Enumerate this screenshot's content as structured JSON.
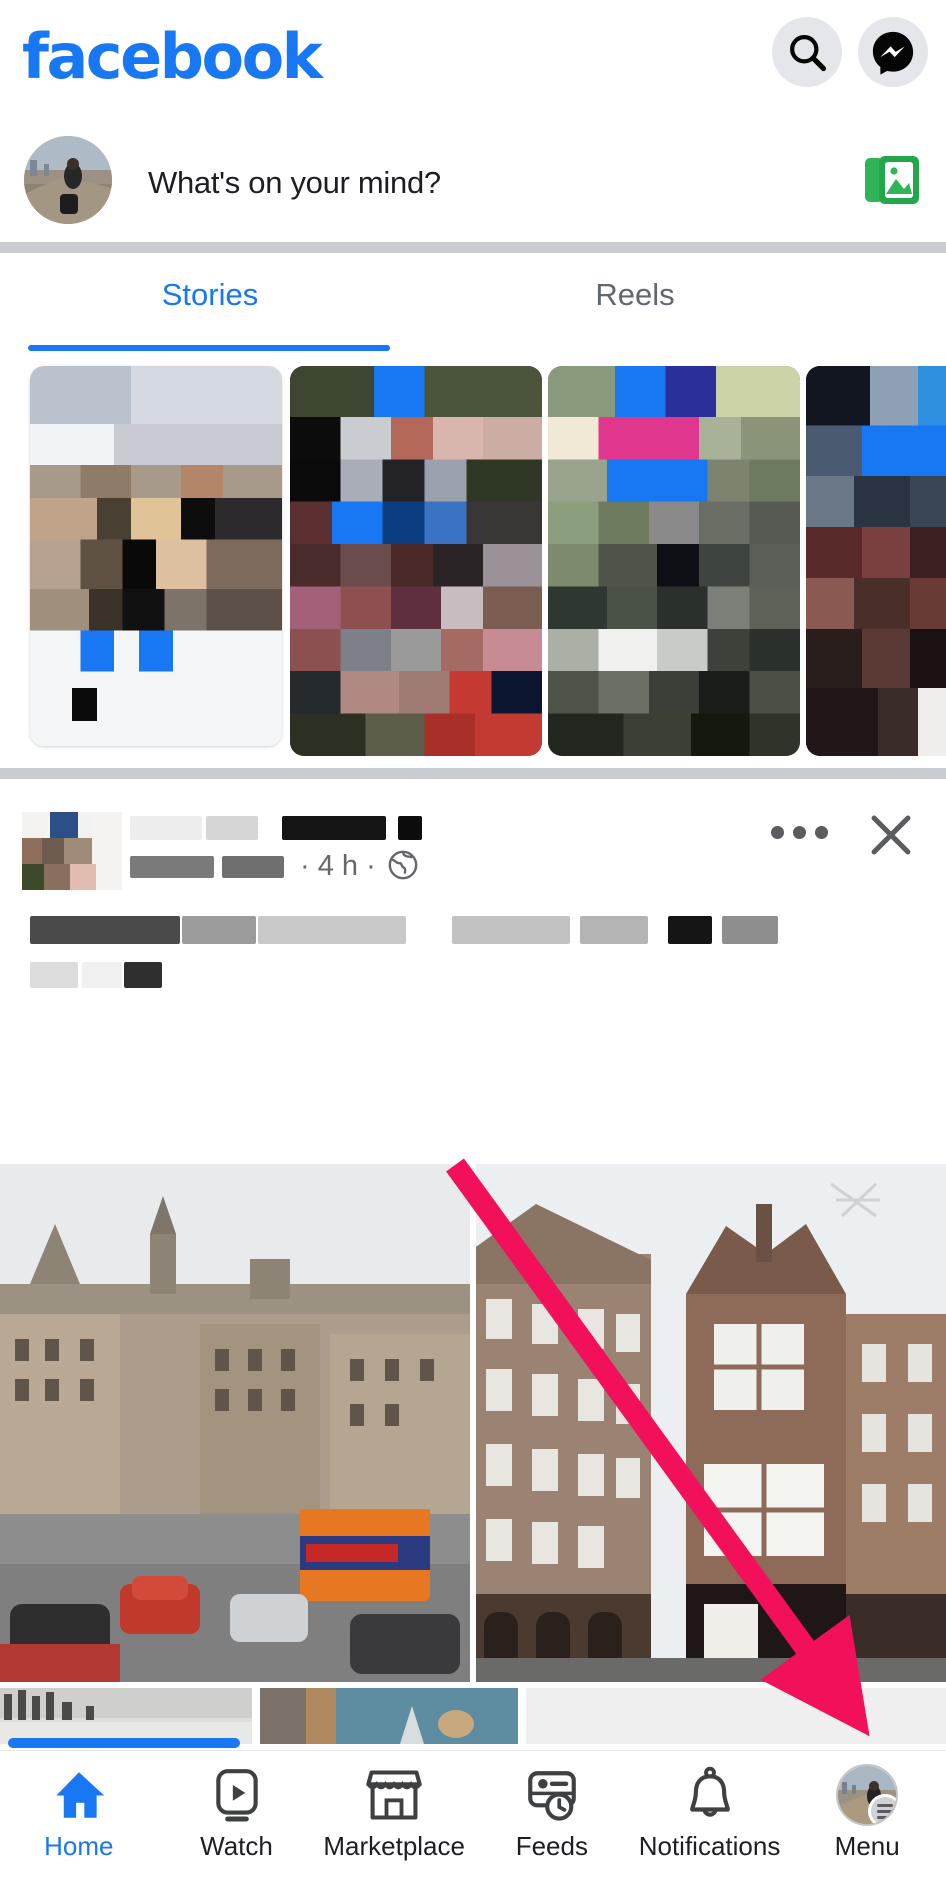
{
  "header": {
    "logo_text": "facebook",
    "logo_color": "#1877F2",
    "search_icon": "search-icon",
    "messenger_icon": "messenger-icon"
  },
  "composer": {
    "placeholder": "What's on your mind?",
    "photo_icon": "photo-gallery-icon",
    "photo_icon_color": "#26A65B",
    "avatar": "user-avatar"
  },
  "tabs": [
    {
      "label": "Stories",
      "active": true
    },
    {
      "label": "Reels",
      "active": false
    }
  ],
  "stories": {
    "items": [
      {
        "name": "story-card-1",
        "redacted": true
      },
      {
        "name": "story-card-2",
        "redacted": true
      },
      {
        "name": "story-card-3",
        "redacted": true
      },
      {
        "name": "story-card-4",
        "redacted": true
      }
    ]
  },
  "post": {
    "author_redacted": true,
    "timestamp": "· 4 h ·",
    "privacy_icon": "globe-public-icon",
    "menu_icon": "ellipsis-icon",
    "close_icon": "close-icon",
    "body_redacted": true,
    "images": [
      {
        "name": "post-photo-1",
        "alt": "street view with buildings and bus"
      },
      {
        "name": "post-photo-2",
        "alt": "stone corner building"
      }
    ]
  },
  "annotation": {
    "arrow_color": "#F2105A",
    "points_to": "menu-tab"
  },
  "bottom_nav": {
    "items": [
      {
        "label": "Home",
        "icon": "home-icon",
        "active": true
      },
      {
        "label": "Watch",
        "icon": "watch-video-icon",
        "active": false
      },
      {
        "label": "Marketplace",
        "icon": "marketplace-store-icon",
        "active": false
      },
      {
        "label": "Feeds",
        "icon": "feeds-clock-icon",
        "active": false
      },
      {
        "label": "Notifications",
        "icon": "bell-icon",
        "active": false
      },
      {
        "label": "Menu",
        "icon": "menu-avatar-icon",
        "active": false
      }
    ],
    "active_color": "#1877F2"
  }
}
